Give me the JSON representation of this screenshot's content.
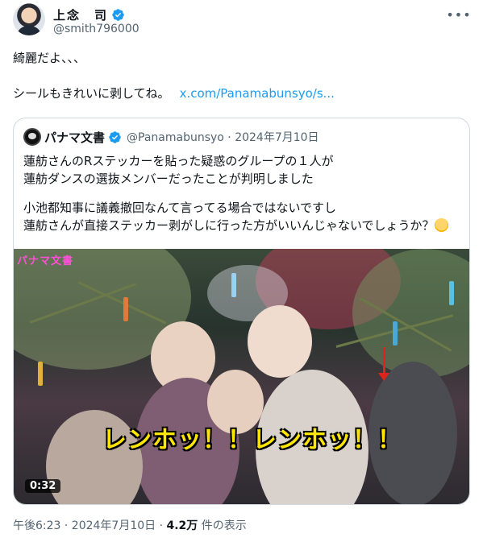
{
  "header": {
    "display_name": "上念　司",
    "handle": "@smith796000",
    "more_label": "•••"
  },
  "tweet": {
    "line1": "綺麗だよ、、、",
    "line2": "シールもきれいに剥してね。",
    "link": "x.com/Panamabunsyo/s..."
  },
  "quote": {
    "name": "パナマ文書",
    "handle_date": "@Panamabunsyo · 2024年7月10日",
    "para1_line1": "蓮舫さんのRステッカーを貼った疑惑のグループの１人が",
    "para1_line2": "蓮舫ダンスの選抜メンバーだったことが判明しました",
    "para2_line1": "小池都知事に議義撤回なんて言ってる場合ではないですし",
    "para2_line2": "蓮舫さんが直接ステッカー剥がしに行った方がいいんじゃないでしょうか？",
    "emoji": "thinking-face-emoji",
    "media": {
      "overlay_label": "パナマ文書",
      "caption": "レンホッ！！レンホッ！！",
      "duration": "0:32"
    }
  },
  "meta": {
    "time_date": "午後6:23 · 2024年7月10日 · ",
    "views_count": "4.2万",
    "views_label": " 件の表示"
  },
  "colors": {
    "accent": "#1d9bf0",
    "text": "#0f1419",
    "muted": "#536471",
    "border": "#cfd9de",
    "caption": "#ffe600",
    "overlay_label": "#ff4fd8"
  }
}
